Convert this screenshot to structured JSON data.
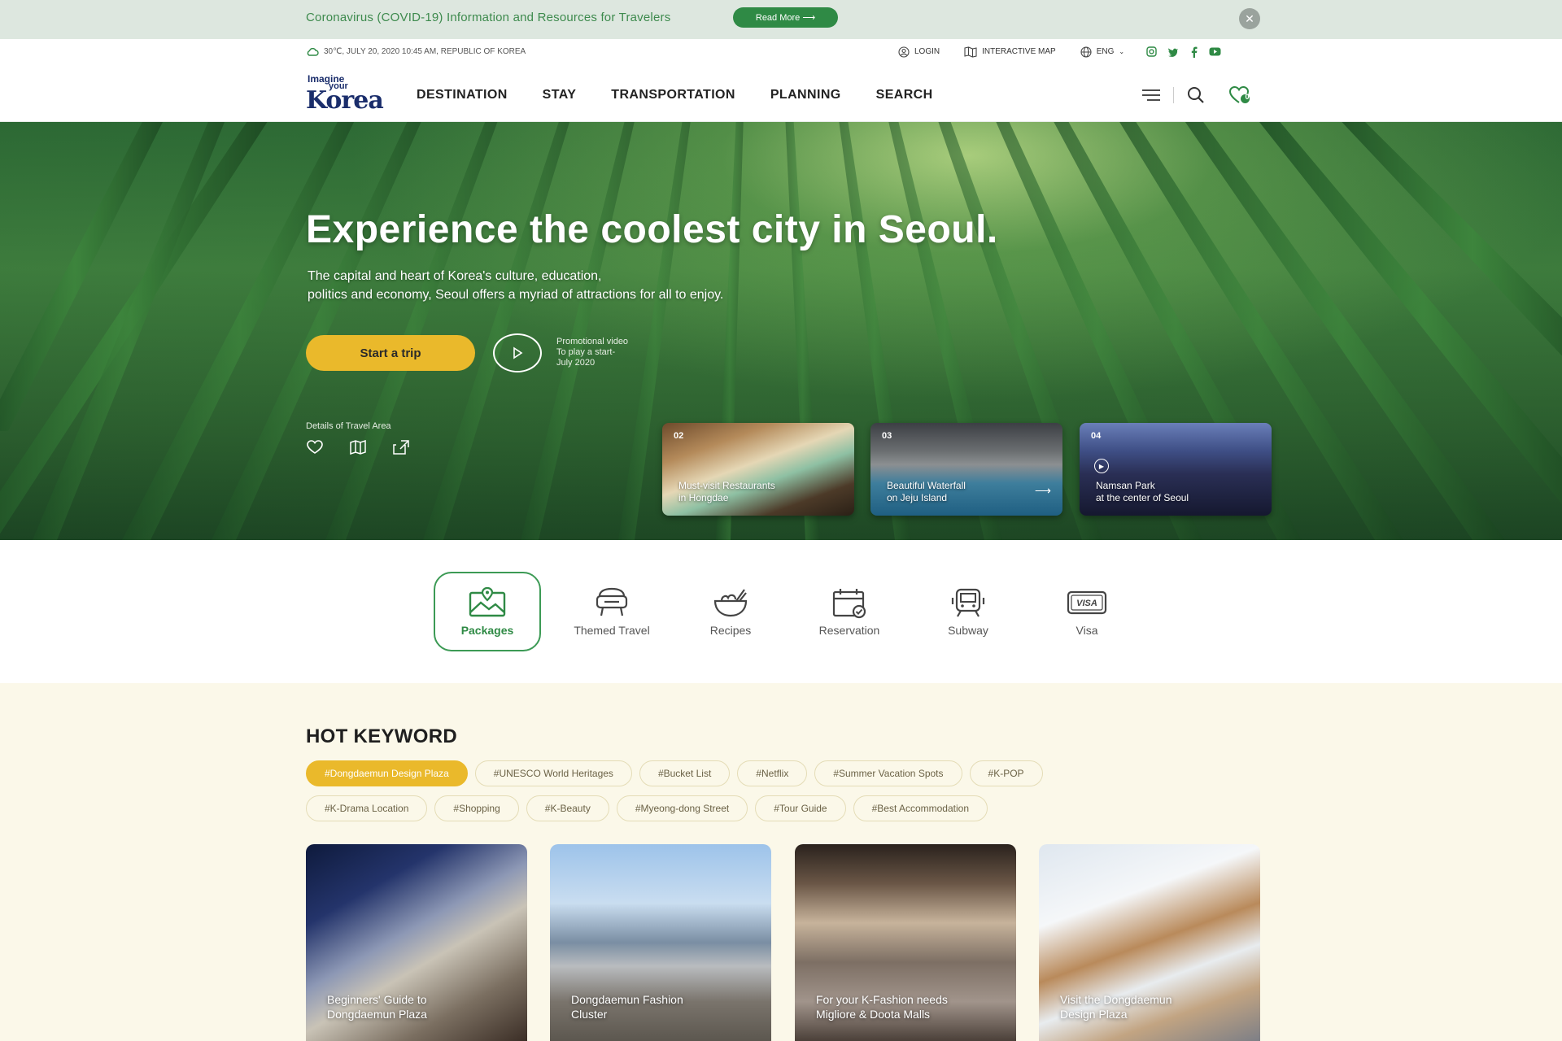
{
  "notice": {
    "text": "Coronavirus (COVID-19) Information and Resources for Travelers",
    "button": "Read More ⟶"
  },
  "util": {
    "weather": "30℃, JULY 20, 2020 10:45 AM, REPUBLIC OF KOREA",
    "login": "LOGIN",
    "map": "INTERACTIVE MAP",
    "lang": "ENG"
  },
  "header": {
    "logo": {
      "line1": "Imagine",
      "line2": "your",
      "line3": "Korea"
    },
    "nav": [
      "DESTINATION",
      "STAY",
      "TRANSPORTATION",
      "PLANNING",
      "SEARCH"
    ],
    "wishlist_count": "0"
  },
  "hero": {
    "title": "Experience the coolest city in Seoul.",
    "subtitle_line1": "The capital and heart of Korea's culture, education,",
    "subtitle_line2": "politics and economy, Seoul offers a myriad of attractions for all to enjoy.",
    "start_button": "Start a trip",
    "promo_line1": "Promotional video",
    "promo_line2": "To play a start-",
    "promo_line3": "July 2020",
    "details_label": "Details of Travel Area",
    "cards": [
      {
        "num": "02",
        "line1": "Must-visit Restaurants",
        "line2": "in Hongdae"
      },
      {
        "num": "03",
        "line1": "Beautiful Waterfall",
        "line2": "on Jeju Island"
      },
      {
        "num": "04",
        "line1": "Namsan Park",
        "line2": "at the center of Seoul"
      }
    ]
  },
  "categories": [
    {
      "label": "Packages",
      "icon": "map-picture-icon",
      "active": true
    },
    {
      "label": "Themed Travel",
      "icon": "vr-headset-icon",
      "active": false
    },
    {
      "label": "Recipes",
      "icon": "bowl-icon",
      "active": false
    },
    {
      "label": "Reservation",
      "icon": "calendar-check-icon",
      "active": false
    },
    {
      "label": "Subway",
      "icon": "train-icon",
      "active": false
    },
    {
      "label": "Visa",
      "icon": "visa-card-icon",
      "active": false
    }
  ],
  "hot": {
    "title": "HOT KEYWORD",
    "row1": [
      "#Dongdaemun Design Plaza",
      "#UNESCO World Heritages",
      "#Bucket List",
      "#Netflix",
      "#Summer Vacation Spots",
      "#K-POP"
    ],
    "row2": [
      "#K-Drama Location",
      "#Shopping",
      "#K-Beauty",
      "#Myeong-dong Street",
      "#Tour Guide",
      "#Best Accommodation"
    ],
    "cards": [
      {
        "line1": "Beginners' Guide to",
        "line2": "Dongdaemun Plaza"
      },
      {
        "line1": "Dongdaemun Fashion",
        "line2": "Cluster"
      },
      {
        "line1": "For your K-Fashion needs",
        "line2": "Migliore & Doota Malls"
      },
      {
        "line1": "Visit the Dongdaemun",
        "line2": "Design Plaza"
      }
    ]
  },
  "colors": {
    "brand_green": "#2f8a45",
    "accent_yellow": "#eab92b",
    "cream": "#fbf8e9"
  }
}
